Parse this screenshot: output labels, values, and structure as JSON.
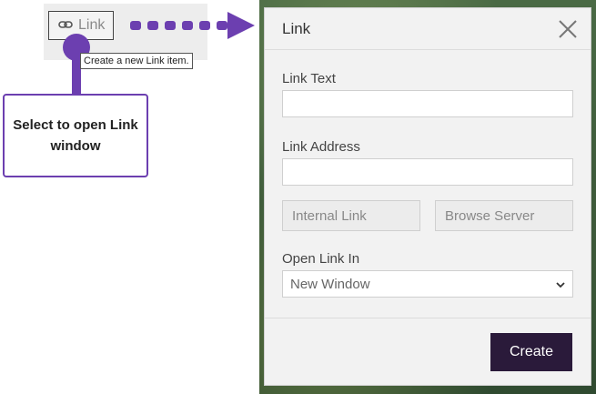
{
  "toolbar": {
    "link_label": "Link",
    "tooltip": "Create a new Link item."
  },
  "callout": {
    "text": "Select to open Link window"
  },
  "dialog": {
    "title": "Link",
    "fields": {
      "link_text_label": "Link Text",
      "link_text_value": "",
      "link_address_label": "Link Address",
      "link_address_value": "",
      "internal_link_label": "Internal Link",
      "browse_server_label": "Browse Server",
      "open_link_in_label": "Open Link In",
      "open_link_in_value": "New Window"
    },
    "create_label": "Create"
  },
  "icons": {
    "link": "link-icon",
    "close": "close-icon",
    "dropdown": "chevron-down-icon"
  },
  "colors": {
    "accent": "#6c3fb0",
    "create_button": "#2a1a3a"
  }
}
